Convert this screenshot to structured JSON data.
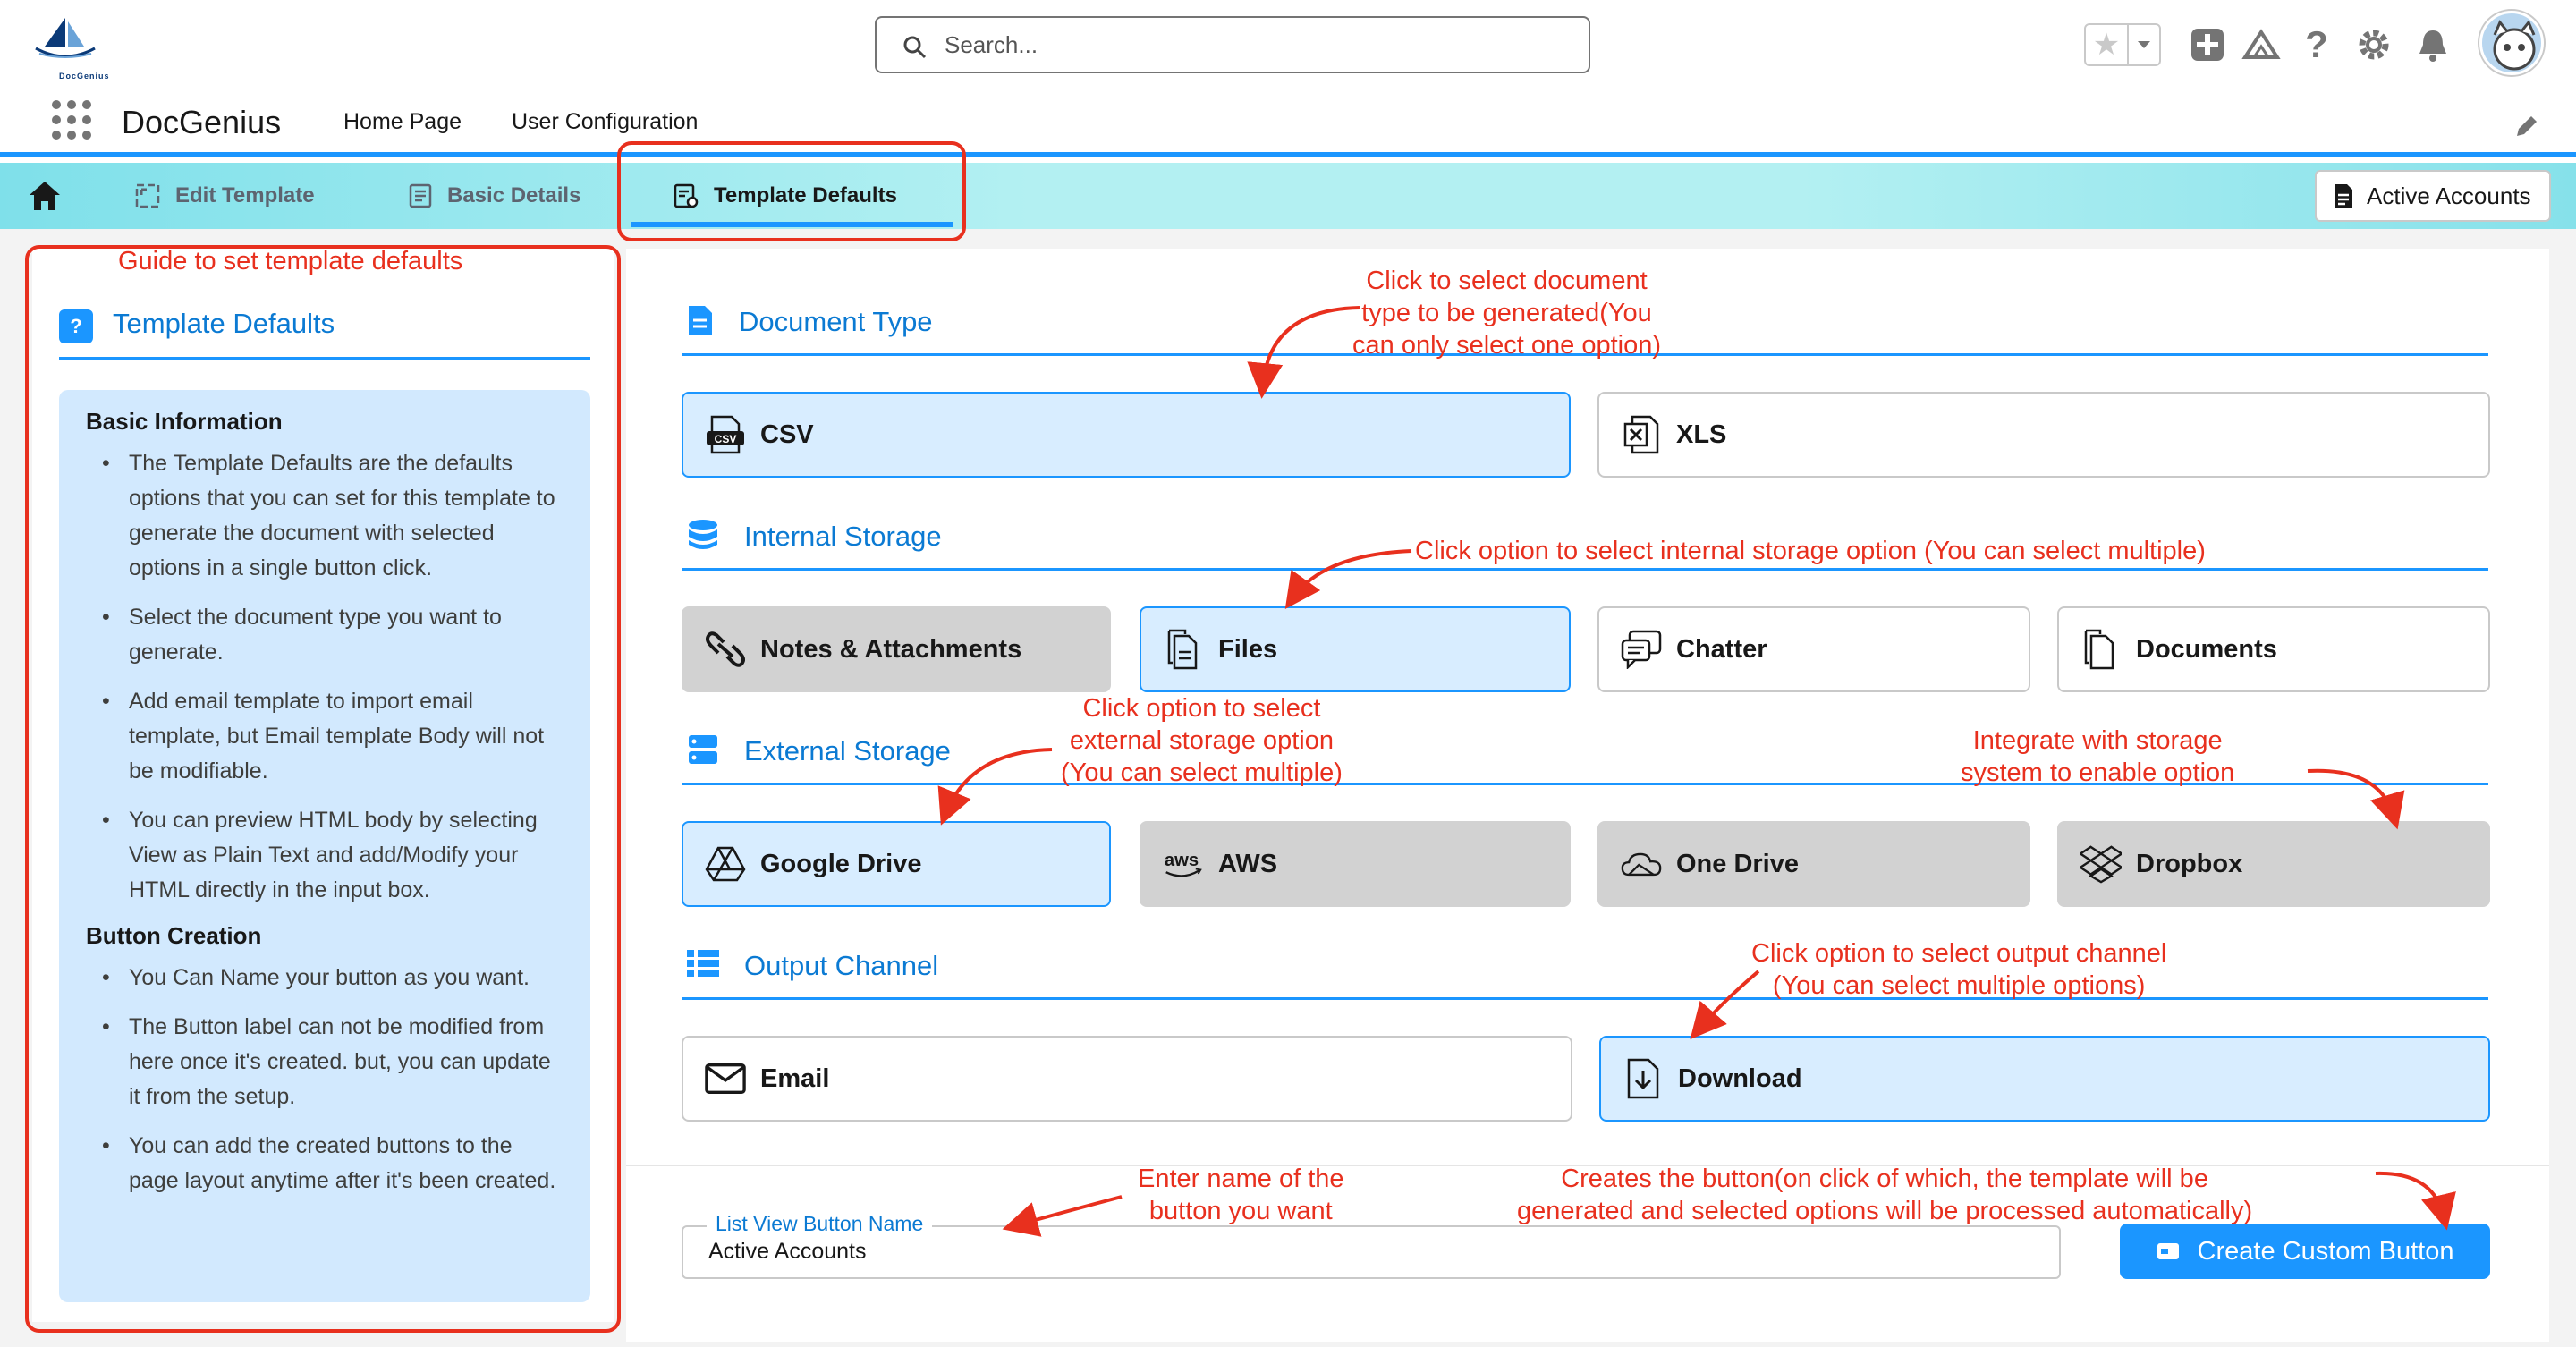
{
  "global_header": {
    "logo_text": "DocGenius",
    "search_placeholder": "Search..."
  },
  "app_nav": {
    "app_name": "DocGenius",
    "items": [
      {
        "label": "Home Page"
      },
      {
        "label": "User Configuration"
      }
    ]
  },
  "tabs": [
    {
      "label": "Edit Template",
      "icon": "edit-template-icon"
    },
    {
      "label": "Basic Details",
      "icon": "details-icon"
    },
    {
      "label": "Template Defaults",
      "icon": "template-defaults-icon",
      "active": true
    }
  ],
  "tab_action": {
    "label": "Active Accounts"
  },
  "guide": {
    "title": "Template Defaults",
    "sections": [
      {
        "heading": "Basic Information",
        "items": [
          "The Template Defaults are the defaults options that you can set for this template to generate the document with selected options in a single button click.",
          "Select the document type you want to generate.",
          "Add email template to import email template, but Email template Body will not be modifiable.",
          "You can preview HTML body by selecting View as Plain Text and add/Modify your HTML directly in the input box."
        ]
      },
      {
        "heading": "Button Creation",
        "items": [
          "You Can Name your button as you want.",
          "The Button label can not be modified from here once it's created. but, you can update it from the setup.",
          "You can add the created buttons to the page layout anytime after it's been created."
        ]
      }
    ]
  },
  "sections": {
    "document_type": {
      "title": "Document Type",
      "options": [
        {
          "label": "CSV",
          "state": "selected",
          "icon": "csv-icon"
        },
        {
          "label": "XLS",
          "state": "normal",
          "icon": "xls-icon"
        }
      ]
    },
    "internal_storage": {
      "title": "Internal Storage",
      "options": [
        {
          "label": "Notes & Attachments",
          "state": "disabled",
          "icon": "attachment-icon"
        },
        {
          "label": "Files",
          "state": "selected",
          "icon": "files-icon"
        },
        {
          "label": "Chatter",
          "state": "normal",
          "icon": "chatter-icon"
        },
        {
          "label": "Documents",
          "state": "normal",
          "icon": "documents-icon"
        }
      ]
    },
    "external_storage": {
      "title": "External Storage",
      "options": [
        {
          "label": "Google Drive",
          "state": "selected",
          "icon": "google-drive-icon"
        },
        {
          "label": "AWS",
          "state": "disabled",
          "icon": "aws-icon"
        },
        {
          "label": "One Drive",
          "state": "disabled",
          "icon": "one-drive-icon"
        },
        {
          "label": "Dropbox",
          "state": "disabled",
          "icon": "dropbox-icon"
        }
      ]
    },
    "output_channel": {
      "title": "Output Channel",
      "options": [
        {
          "label": "Email",
          "state": "normal",
          "icon": "email-icon"
        },
        {
          "label": "Download",
          "state": "selected",
          "icon": "download-icon"
        }
      ]
    }
  },
  "footer": {
    "name_label": "List View Button Name",
    "name_value": "Active Accounts",
    "create_button": "Create Custom Button"
  },
  "annotations": {
    "guide": "Guide to set template defaults",
    "doc_type": [
      "Click to select document",
      "type to be generated(You",
      "can only select one option)"
    ],
    "internal": "Click option to select internal storage option (You can select multiple)",
    "external": [
      "Click option to select",
      "external storage option",
      "(You can select multiple)"
    ],
    "integrate": [
      "Integrate with storage",
      "system to enable option"
    ],
    "output": [
      "Click option to select output channel",
      "(You can select multiple options)"
    ],
    "button_name": [
      "Enter name of the",
      "button you want"
    ],
    "create": [
      "Creates the button(on click of which, the template will be",
      "generated and selected options will be processed automatically)"
    ],
    "color": "#e8301e"
  },
  "colors": {
    "accent": "#1b96ff",
    "title_blue": "#0b7ad3",
    "selected_bg": "#d8edff",
    "disabled_bg": "#d2d2d2",
    "guide_bg": "#d2e9fe"
  }
}
